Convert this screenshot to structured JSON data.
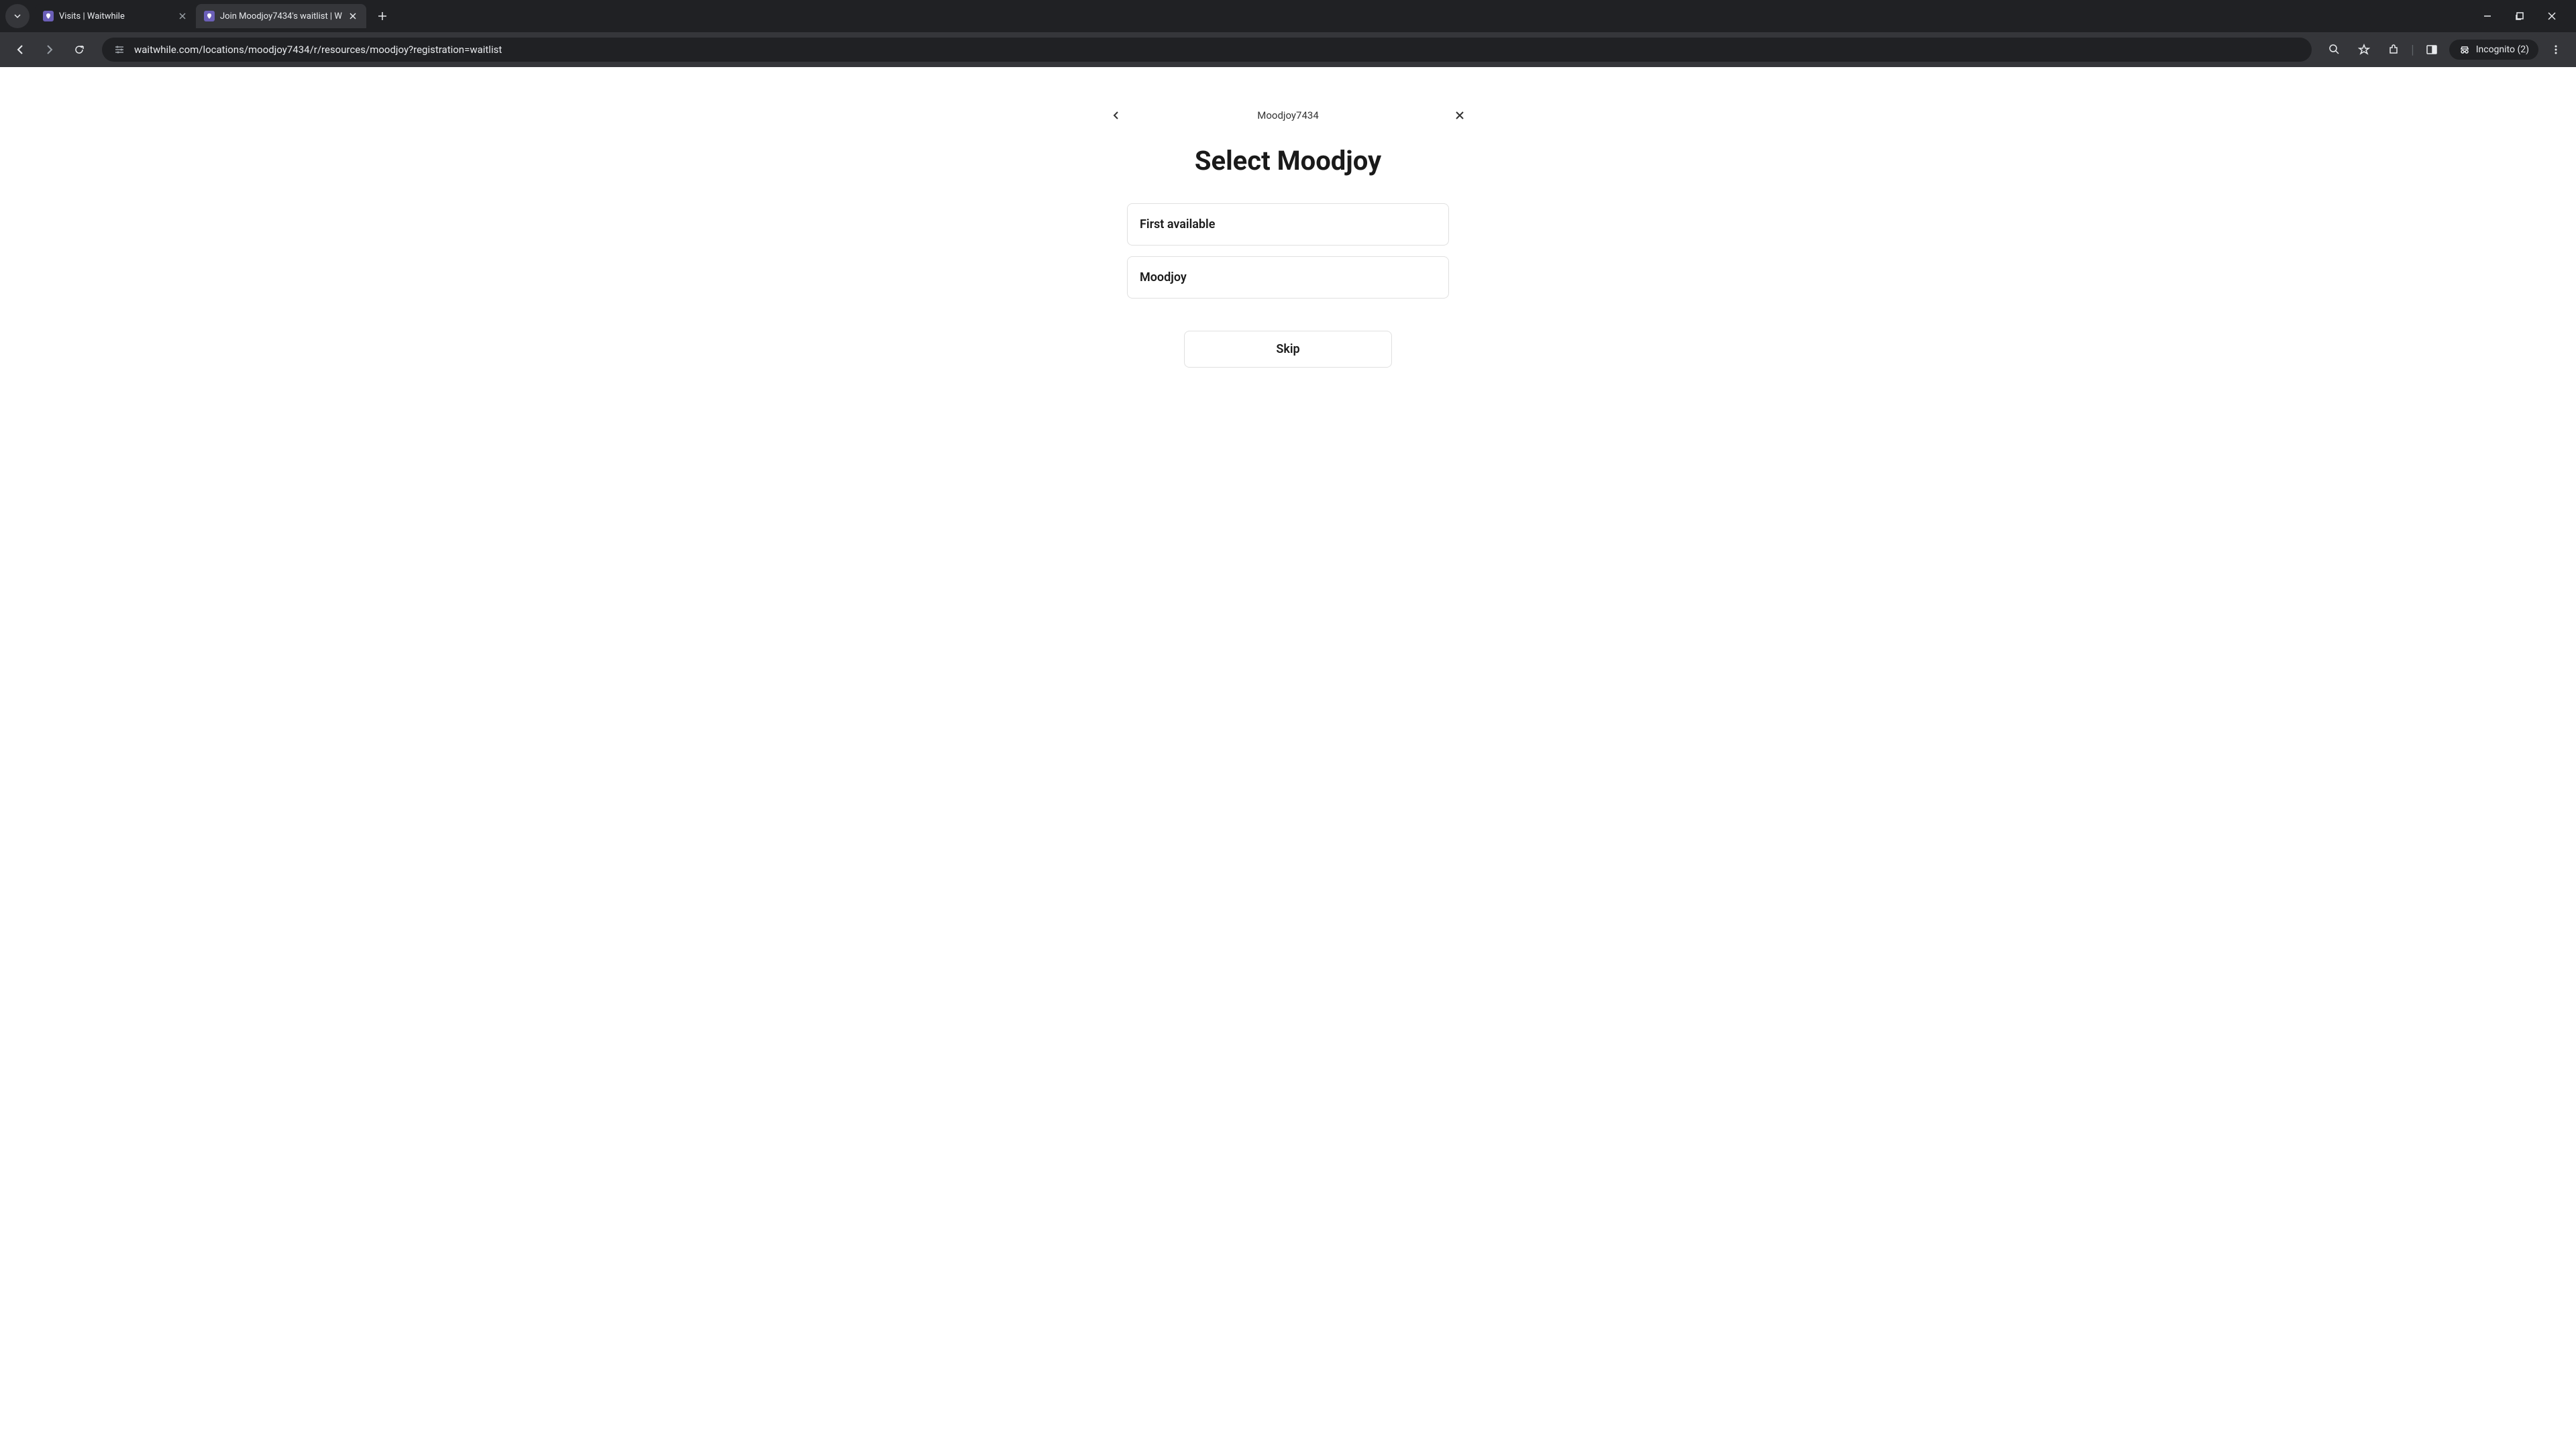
{
  "browser": {
    "tabs": [
      {
        "title": "Visits | Waitwhile",
        "active": false
      },
      {
        "title": "Join Moodjoy7434's waitlist | W",
        "active": true
      }
    ],
    "url": "waitwhile.com/locations/moodjoy7434/r/resources/moodjoy?registration=waitlist",
    "incognito_label": "Incognito (2)"
  },
  "page": {
    "location_name": "Moodjoy7434",
    "title": "Select Moodjoy",
    "options": [
      {
        "label": "First available"
      },
      {
        "label": "Moodjoy"
      }
    ],
    "skip_label": "Skip"
  }
}
